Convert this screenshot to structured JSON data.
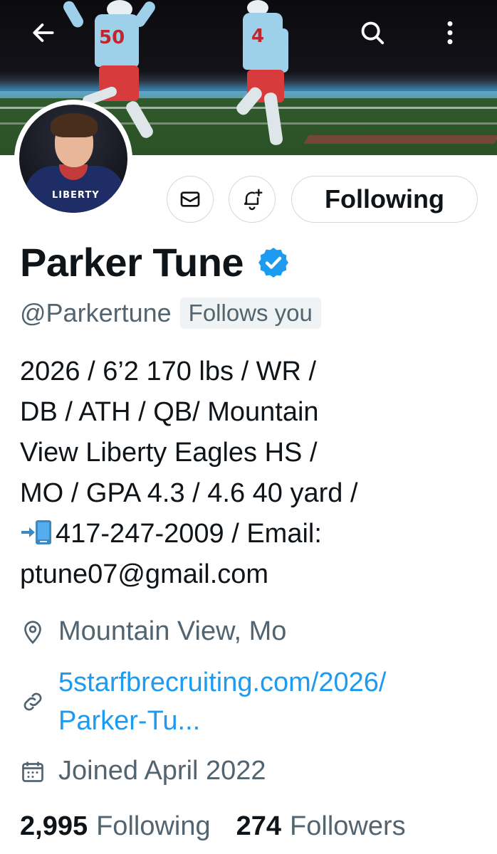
{
  "header": {
    "back_icon": "arrow-left-icon",
    "search_icon": "search-icon",
    "more_icon": "more-vertical-icon",
    "banner_jersey_numbers": [
      "50",
      "4"
    ]
  },
  "avatar": {
    "jersey_text": "LIBERTY"
  },
  "actions": {
    "message_icon": "envelope-icon",
    "notify_icon": "bell-plus-icon",
    "following_label": "Following"
  },
  "profile": {
    "name": "Parker Tune",
    "handle": "@Parkertune",
    "follows_you": "Follows you",
    "bio_lines": [
      "2026 / 6’2 170 lbs / WR /",
      "DB / ATH / QB/ Mountain",
      "View Liberty Eagles HS /",
      "MO / GPA 4.3 / 4.6 40 yard /",
      "417-247-2009 / Email:",
      "ptune07@gmail.com"
    ],
    "location": "Mountain View, Mo",
    "website_line1": "5starfbrecruiting.com/2026/",
    "website_line2": "Parker-Tu...",
    "joined": "Joined April 2022"
  },
  "stats": {
    "following_count": "2,995",
    "following_label": "Following",
    "followers_count": "274",
    "followers_label": "Followers"
  },
  "colors": {
    "accent": "#1d9bf0",
    "secondary_text": "#536471",
    "primary_text": "#0f1419",
    "border": "#cfd9de"
  }
}
